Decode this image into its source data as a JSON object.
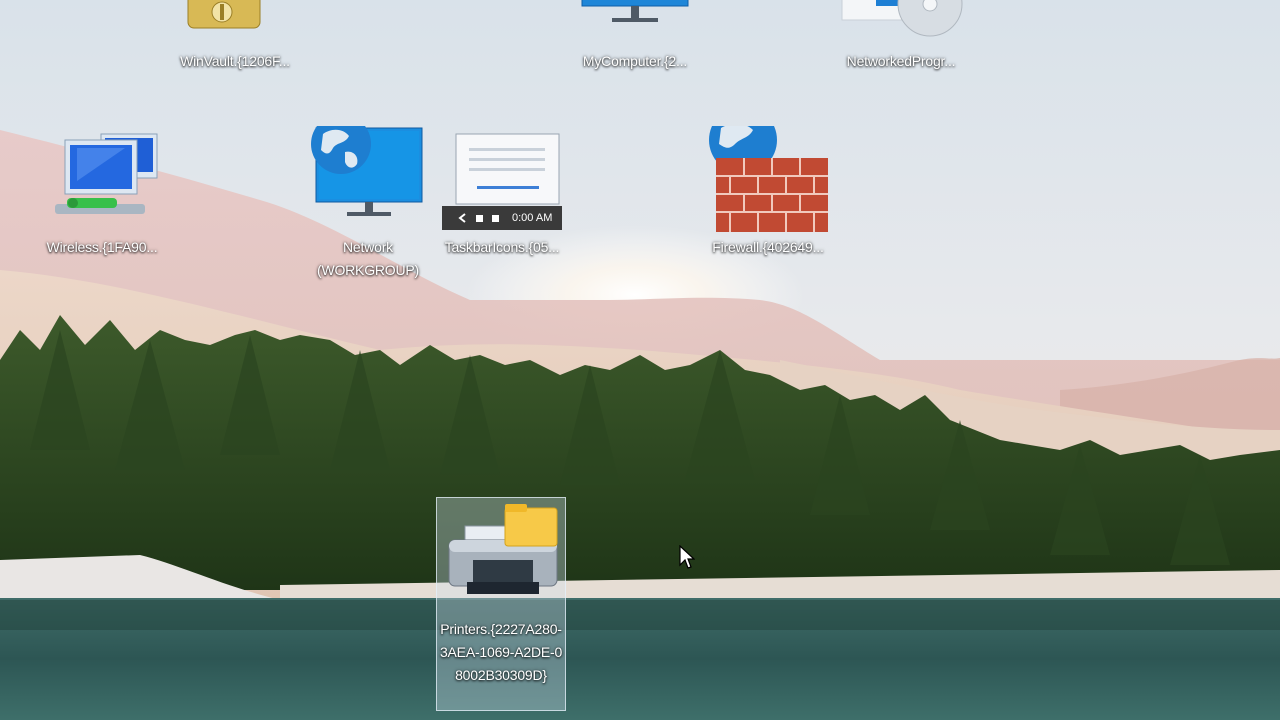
{
  "desktop": {
    "icons": [
      {
        "id": "winvault",
        "label": "WinVault.{1206F..."
      },
      {
        "id": "mycomputer",
        "label": "MyComputer.{2..."
      },
      {
        "id": "networkedprograms",
        "label": "NetworkedProgr..."
      },
      {
        "id": "wireless",
        "label": "Wireless.{1FA90..."
      },
      {
        "id": "network",
        "label": "Network (WORKGROUP)"
      },
      {
        "id": "taskbaricons",
        "label": "TaskbarIcons.{05..."
      },
      {
        "id": "firewall",
        "label": "Firewall.{402649..."
      },
      {
        "id": "printers",
        "label": "Printers.{2227A280-3AEA-1069-A2DE-08002B30309D}"
      }
    ],
    "taskbar_preview_time": "0:00 AM",
    "colors": {
      "selection": "#d2e1f0",
      "sky": "#dfe7ee",
      "water": "#2f5a56",
      "forest": "#2d4a22"
    }
  }
}
